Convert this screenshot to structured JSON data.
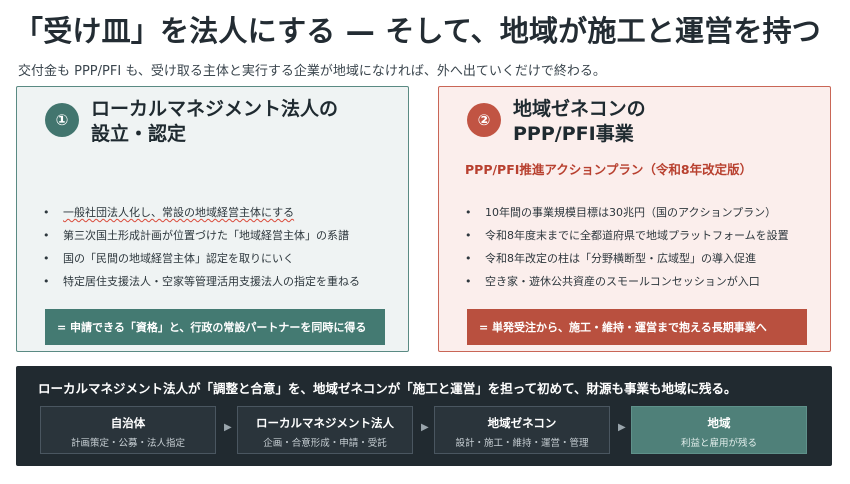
{
  "header": {
    "title": "「受け皿」を法人にする — そして、地域が施工と運営を持つ",
    "subtitle": "交付金も PPP/PFI も、受け取る主体と実行する企業が地域になければ、外へ出ていくだけで終わる。"
  },
  "cards": [
    {
      "badge": "①",
      "title_line1": "ローカルマネジメント法人の",
      "title_line2": "設立・認定",
      "subheading": "",
      "bullets": [
        "一般社団法人化し、常設の地域経営主体にする",
        "第三次国土形成計画が位置づけた「地域経営主体」の系譜",
        "国の「民間の地域経営主体」認定を取りにいく",
        "特定居住支援法人・空家等管理活用支援法人の指定を重ねる"
      ],
      "callout": "= 申請できる「資格」と、行政の常設パートナーを同時に得る"
    },
    {
      "badge": "②",
      "title_line1": "地域ゼネコンの",
      "title_line2": "PPP/PFI事業",
      "subheading": "PPP/PFI推進アクションプラン（令和8年改定版）",
      "bullets": [
        "10年間の事業規模目標は30兆円（国のアクションプラン）",
        "令和8年度末までに全都道府県で地域プラットフォームを設置",
        "令和8年改定の柱は「分野横断型・広域型」の導入促進",
        "空き家・遊休公共資産のスモールコンセッションが入口"
      ],
      "callout": "= 単発受注から、施工・維持・運営まで抱える長期事業へ"
    }
  ],
  "footer": {
    "headline": "ローカルマネジメント法人が「調整と合意」を、地域ゼネコンが「施工と運営」を担って初めて、財源も事業も地域に残る。",
    "flow": [
      {
        "name": "自治体",
        "desc": "計画策定・公募・法人指定"
      },
      {
        "name": "ローカルマネジメント法人",
        "desc": "企画・合意形成・申請・受託"
      },
      {
        "name": "地域ゼネコン",
        "desc": "設計・施工・維持・運営・管理"
      },
      {
        "name": "地域",
        "desc": "利益と雇用が残る"
      }
    ],
    "arrow": "▶"
  },
  "colors": {
    "teal": "#447a72",
    "red": "#b9503f",
    "dark": "#212a30"
  }
}
